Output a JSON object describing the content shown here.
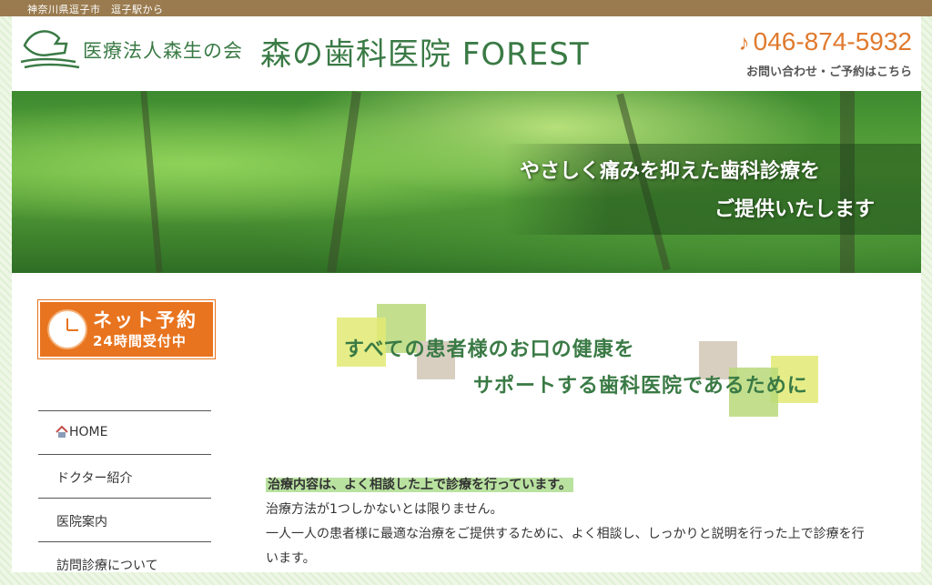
{
  "topbar": {
    "location": "神奈川県逗子市　逗子駅から"
  },
  "header": {
    "org_name": "医療法人森生の会",
    "clinic_name": "森の歯科医院 FOREST",
    "phone": "046-874-5932",
    "contact_label": "お問い合わせ・ご予約はこちら",
    "phone_icon": "phone-icon",
    "logo_icon": "forest-logo-icon"
  },
  "hero": {
    "line1": "やさしく痛みを抑えた歯科診療を",
    "line2": "ご提供いたします"
  },
  "reserve_banner": {
    "title": "ネット予約",
    "subtitle": "24時間受付中",
    "icon": "clock-icon",
    "color": "#e8741f"
  },
  "sidebar": {
    "items": [
      {
        "label": "HOME",
        "icon": "home-icon"
      },
      {
        "label": "ドクター紹介"
      },
      {
        "label": "医院案内"
      },
      {
        "label": "訪問診療について"
      }
    ]
  },
  "tagline": {
    "line1": "すべての患者様のお口の健康を",
    "line2": "サポートする歯科医院であるために"
  },
  "intro": {
    "heading": "治療内容は、よく相談した上で診療を行っています。",
    "p1": "治療方法が1つしかないとは限りません。",
    "p2": "一人一人の患者様に最適な治療をご提供するために、よく相談し、しっかりと説明を行った上で診療を行",
    "p3": "います。"
  },
  "colors": {
    "brand_green": "#3a7a45",
    "accent_orange": "#e07a2e",
    "topbar_brown": "#9a7b4f"
  }
}
